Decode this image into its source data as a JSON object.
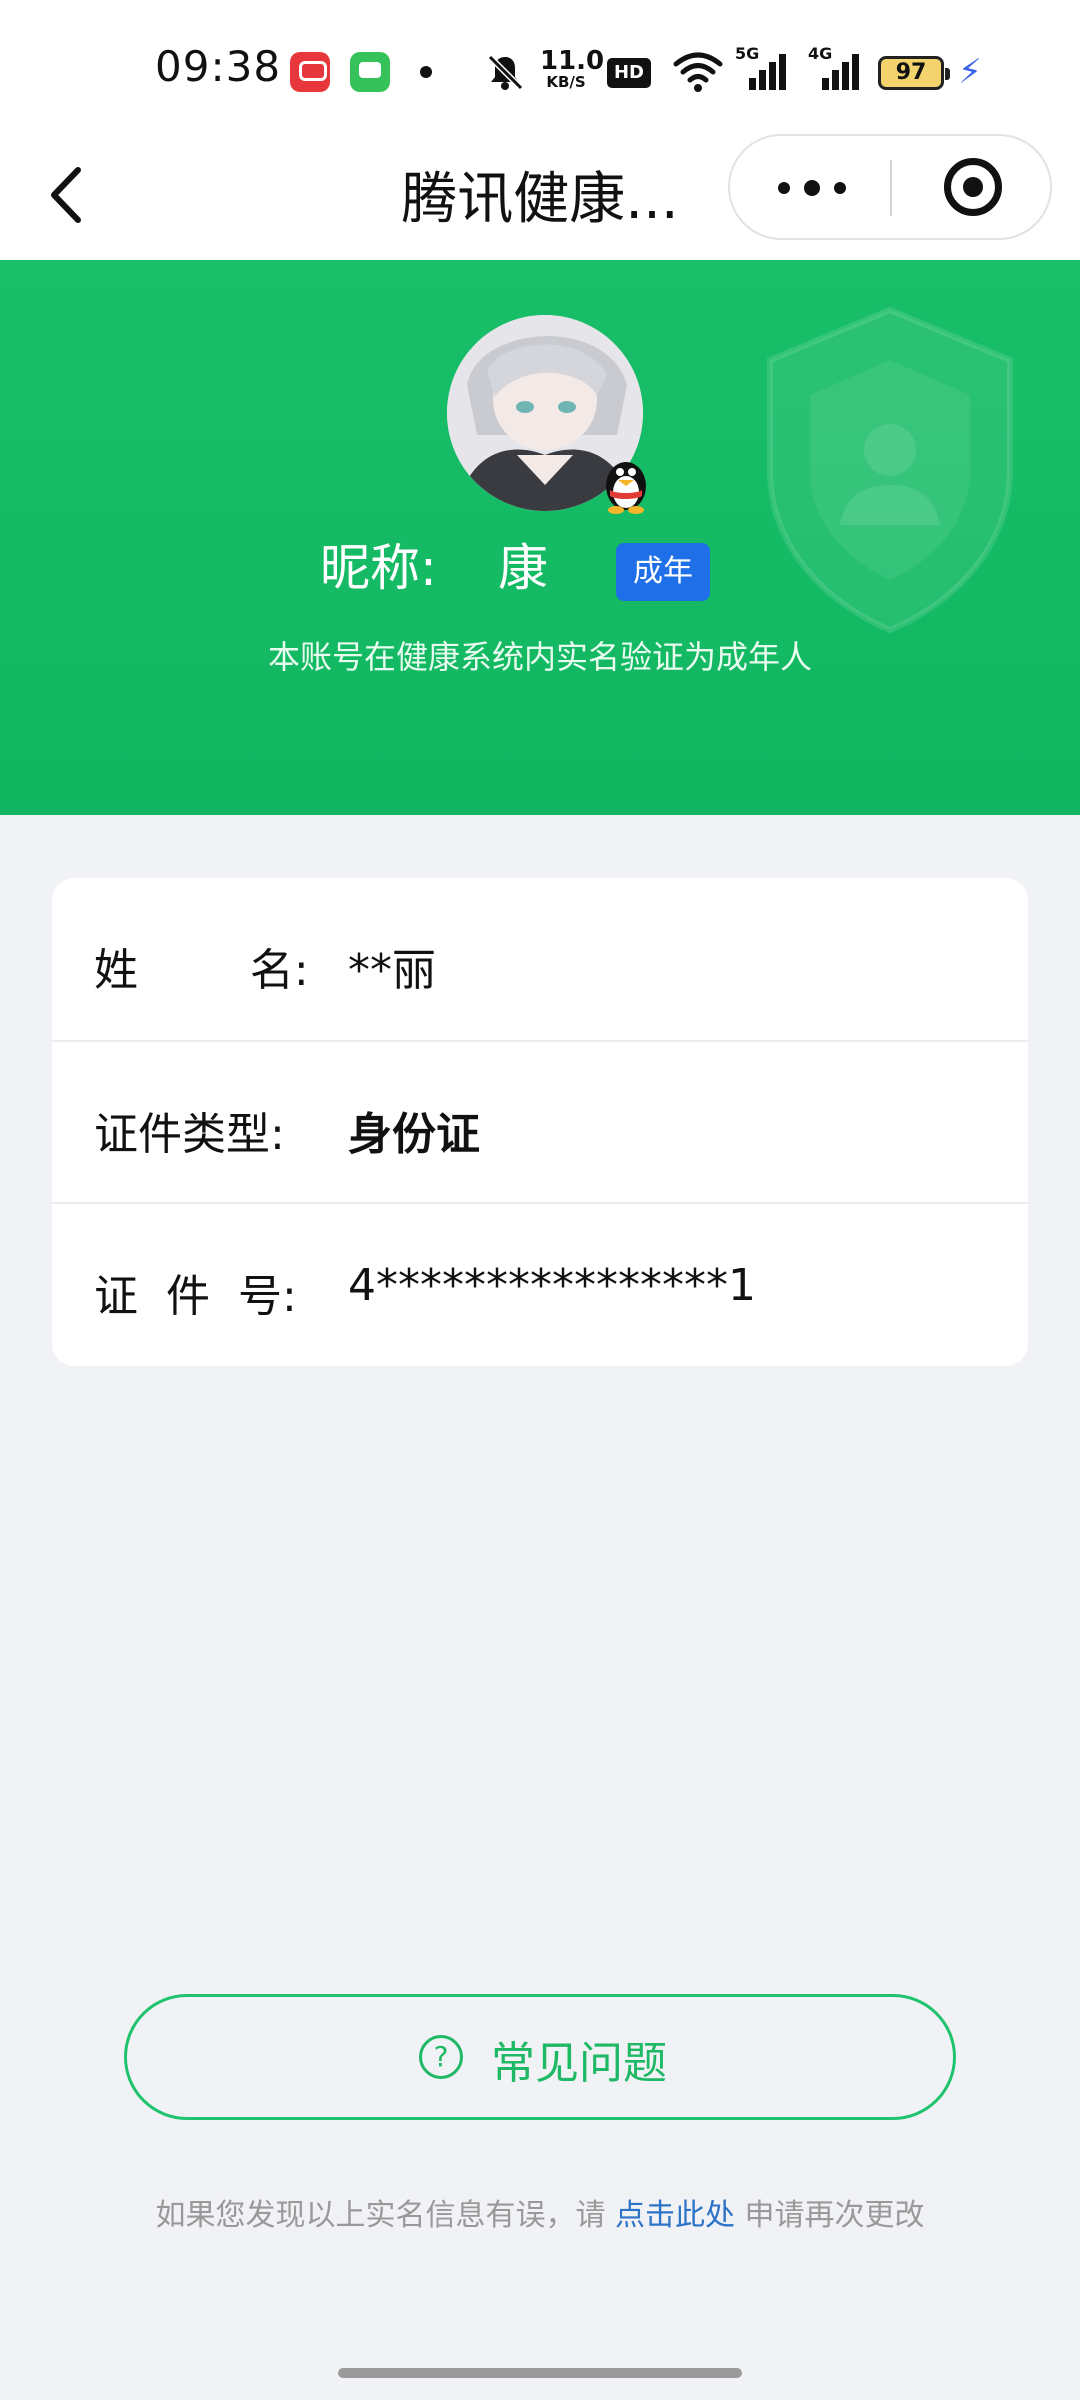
{
  "status_bar": {
    "time": "09:38",
    "net_speed_value": "11.0",
    "net_speed_unit": "KB/S",
    "hd_label": "HD",
    "sim1_label": "5G",
    "sim2_label": "4G",
    "battery": "97",
    "icons": [
      "app-red-icon",
      "app-green-icon",
      "dot-icon",
      "mute-icon",
      "wifi-icon",
      "signal-icon",
      "signal-icon",
      "battery-icon",
      "charging-icon"
    ]
  },
  "titlebar": {
    "title": "腾讯健康...",
    "back_icon": "chevron-left-icon",
    "more_icon": "more-dots-icon",
    "close_icon": "target-icon"
  },
  "profile": {
    "nickname_label": "昵称:",
    "nickname_value": "康",
    "badge": "成年",
    "description": "本账号在健康系统内实名验证为成年人"
  },
  "info": {
    "rows": [
      {
        "label": "姓        名:",
        "value": "**丽",
        "bold": false
      },
      {
        "label": "证件类型:",
        "value": "身份证",
        "bold": true
      },
      {
        "label": "证  件  号:",
        "value": "4****************1",
        "bold": false
      }
    ]
  },
  "faq": {
    "label": "常见问题",
    "icon": "question-circle-icon"
  },
  "footer": {
    "prefix": "如果您发现以上实名信息有误，请 ",
    "link": "点击此处",
    "suffix": " 申请再次更改"
  },
  "colors": {
    "brand_green": "#1fc36d",
    "badge_blue": "#1f6fe8",
    "link_blue": "#2d74c8",
    "background": "#f1f2f5"
  }
}
